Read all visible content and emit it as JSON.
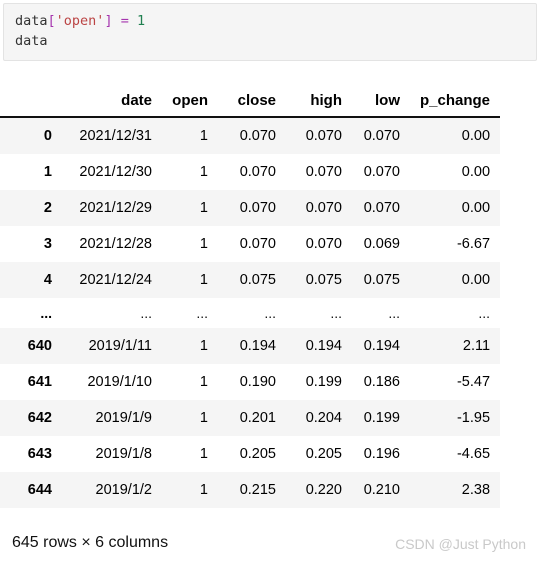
{
  "code_cell": {
    "lines": [
      [
        {
          "text": "data",
          "kind": "name"
        },
        {
          "text": "[",
          "kind": "punct"
        },
        {
          "text": "'open'",
          "kind": "str"
        },
        {
          "text": "]",
          "kind": "punct"
        },
        {
          "text": " ",
          "kind": "name"
        },
        {
          "text": "=",
          "kind": "op"
        },
        {
          "text": " ",
          "kind": "name"
        },
        {
          "text": "1",
          "kind": "num"
        }
      ],
      [
        {
          "text": "data",
          "kind": "name"
        }
      ]
    ],
    "line1_plain": "data['open'] = 1",
    "line2_plain": "data"
  },
  "dataframe": {
    "index_header": "",
    "columns": [
      "date",
      "open",
      "close",
      "high",
      "low",
      "p_change"
    ],
    "rows": [
      {
        "index": "0",
        "cells": [
          "2021/12/31",
          "1",
          "0.070",
          "0.070",
          "0.070",
          "0.00"
        ]
      },
      {
        "index": "1",
        "cells": [
          "2021/12/30",
          "1",
          "0.070",
          "0.070",
          "0.070",
          "0.00"
        ]
      },
      {
        "index": "2",
        "cells": [
          "2021/12/29",
          "1",
          "0.070",
          "0.070",
          "0.070",
          "0.00"
        ]
      },
      {
        "index": "3",
        "cells": [
          "2021/12/28",
          "1",
          "0.070",
          "0.070",
          "0.069",
          "-6.67"
        ]
      },
      {
        "index": "4",
        "cells": [
          "2021/12/24",
          "1",
          "0.075",
          "0.075",
          "0.075",
          "0.00"
        ]
      },
      {
        "index": "...",
        "cells": [
          "...",
          "...",
          "...",
          "...",
          "...",
          "..."
        ],
        "is_ellipsis": true
      },
      {
        "index": "640",
        "cells": [
          "2019/1/11",
          "1",
          "0.194",
          "0.194",
          "0.194",
          "2.11"
        ]
      },
      {
        "index": "641",
        "cells": [
          "2019/1/10",
          "1",
          "0.190",
          "0.199",
          "0.186",
          "-5.47"
        ]
      },
      {
        "index": "642",
        "cells": [
          "2019/1/9",
          "1",
          "0.201",
          "0.204",
          "0.199",
          "-1.95"
        ]
      },
      {
        "index": "643",
        "cells": [
          "2019/1/8",
          "1",
          "0.205",
          "0.205",
          "0.196",
          "-4.65"
        ]
      },
      {
        "index": "644",
        "cells": [
          "2019/1/2",
          "1",
          "0.215",
          "0.220",
          "0.210",
          "2.38"
        ]
      }
    ]
  },
  "footer": {
    "shape": "645 rows × 6 columns",
    "watermark": "CSDN @Just Python"
  },
  "colors": {
    "stripe": "#f5f5f5",
    "code_bg": "#f5f5f5",
    "code_border": "#e3e3e3",
    "header_rule": "#111111",
    "text": "#000000",
    "watermark": "#c9c9c9",
    "string_token": "#bb4444",
    "punct_token": "#a535ae",
    "number_token": "#208050"
  }
}
